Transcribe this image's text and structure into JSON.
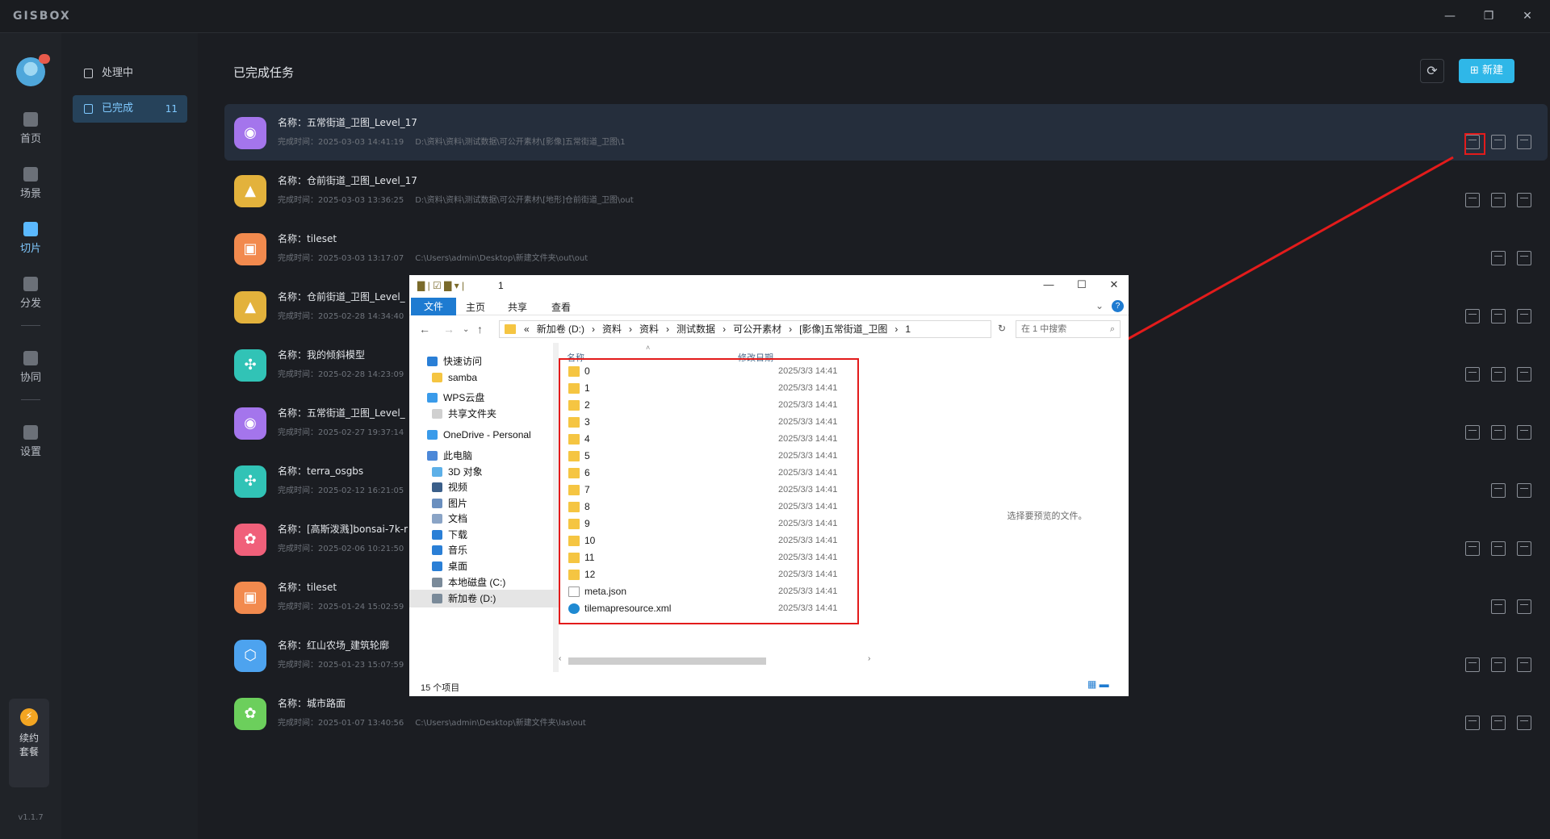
{
  "app": {
    "logo": "GISBOX",
    "version": "v1.1.7"
  },
  "window_controls": {
    "minimize": "—",
    "restore": "❐",
    "close": "✕"
  },
  "rail": {
    "items": [
      {
        "label": "首页",
        "icon": "home-icon"
      },
      {
        "label": "场景",
        "icon": "scene-icon"
      },
      {
        "label": "切片",
        "icon": "tile-icon",
        "active": true
      },
      {
        "label": "分发",
        "icon": "publish-icon"
      },
      {
        "label": "协同",
        "icon": "lock-icon"
      },
      {
        "label": "设置",
        "icon": "settings-icon"
      }
    ],
    "promo": {
      "label": "续约\n套餐",
      "bolt": "⚡"
    }
  },
  "sidenav": {
    "processing": "处理中",
    "done": "已完成",
    "done_count": "11"
  },
  "main": {
    "title": "已完成任务",
    "refresh_glyph": "⟳",
    "new_label": "新建"
  },
  "tasks": [
    {
      "name": "名称：五常街道_卫图_Level_17",
      "time": "完成时间：2025-03-03 14:41:19",
      "path": "D:\\资料\\资料\\测试数据\\可公开素材\\[影像]五常街道_卫图\\1",
      "color": "#a475ec",
      "glyph": "◉"
    },
    {
      "name": "名称：仓前街道_卫图_Level_17",
      "time": "完成时间：2025-03-03 13:36:25",
      "path": "D:\\资料\\资料\\测试数据\\可公开素材\\[地形]仓前街道_卫图\\out",
      "color": "#e3b23c",
      "glyph": "▲"
    },
    {
      "name": "名称：tileset",
      "time": "完成时间：2025-03-03 13:17:07",
      "path": "C:\\Users\\admin\\Desktop\\新建文件夹\\out\\out",
      "color": "#f28a4e",
      "glyph": "▣"
    },
    {
      "name": "名称：仓前街道_卫图_Level_",
      "time": "完成时间：2025-02-28 14:34:40",
      "path": "",
      "color": "#e3b23c",
      "glyph": "▲"
    },
    {
      "name": "名称：我的倾斜模型",
      "time": "完成时间：2025-02-28 14:23:09",
      "path": "",
      "color": "#31c3b6",
      "glyph": "✣"
    },
    {
      "name": "名称：五常街道_卫图_Level_",
      "time": "完成时间：2025-02-27 19:37:14",
      "path": "",
      "color": "#a475ec",
      "glyph": "◉"
    },
    {
      "name": "名称：terra_osgbs",
      "time": "完成时间：2025-02-12 16:21:05",
      "path": "",
      "color": "#31c3b6",
      "glyph": "✣"
    },
    {
      "name": "名称：[高斯泼溅]bonsai-7k-r",
      "time": "完成时间：2025-02-06 10:21:50",
      "path": "",
      "color": "#f0607a",
      "glyph": "✿"
    },
    {
      "name": "名称：tileset",
      "time": "完成时间：2025-01-24 15:02:59",
      "path": "",
      "color": "#f28a4e",
      "glyph": "▣"
    },
    {
      "name": "名称：红山农场_建筑轮廓",
      "time": "完成时间：2025-01-23 15:07:59",
      "path": "",
      "color": "#4da3ef",
      "glyph": "⬡"
    },
    {
      "name": "名称：城市路面",
      "time": "完成时间：2025-01-07 13:40:56",
      "path": "C:\\Users\\admin\\Desktop\\新建文件夹\\las\\out",
      "color": "#6ccf5c",
      "glyph": "✿"
    }
  ],
  "explorer": {
    "title": "1",
    "ribbon": {
      "file": "文件",
      "home": "主页",
      "share": "共享",
      "view": "查看",
      "help": "?"
    },
    "address": [
      "«",
      "新加卷 (D:)",
      "›",
      "资料",
      "›",
      "资料",
      "›",
      "测试数据",
      "›",
      "可公开素材",
      "›",
      "[影像]五常街道_卫图",
      "›",
      "1"
    ],
    "search_placeholder": "在 1 中搜索",
    "tree": [
      {
        "label": "快速访问",
        "color": "#2a7fd6"
      },
      {
        "label": "samba",
        "color": "#f5c542"
      },
      {
        "label": "WPS云盘",
        "color": "#3a9bea"
      },
      {
        "label": "共享文件夹",
        "color": "#d0d0d0"
      },
      {
        "label": "OneDrive - Personal",
        "color": "#3a9bea"
      },
      {
        "label": "此电脑",
        "color": "#4c88d8"
      },
      {
        "label": "3D 对象",
        "color": "#5db0e8"
      },
      {
        "label": "视频",
        "color": "#3b5f8a"
      },
      {
        "label": "图片",
        "color": "#6a8fbf"
      },
      {
        "label": "文档",
        "color": "#8aa4c6"
      },
      {
        "label": "下载",
        "color": "#2a7fd6"
      },
      {
        "label": "音乐",
        "color": "#2a7fd6"
      },
      {
        "label": "桌面",
        "color": "#2a7fd6"
      },
      {
        "label": "本地磁盘 (C:)",
        "color": "#7a8a99"
      },
      {
        "label": "新加卷 (D:)",
        "color": "#7a8a99"
      }
    ],
    "columns": {
      "name": "名称",
      "modified": "修改日期"
    },
    "files": [
      {
        "name": "0",
        "date": "2025/3/3 14:41",
        "type": "folder"
      },
      {
        "name": "1",
        "date": "2025/3/3 14:41",
        "type": "folder"
      },
      {
        "name": "2",
        "date": "2025/3/3 14:41",
        "type": "folder"
      },
      {
        "name": "3",
        "date": "2025/3/3 14:41",
        "type": "folder"
      },
      {
        "name": "4",
        "date": "2025/3/3 14:41",
        "type": "folder"
      },
      {
        "name": "5",
        "date": "2025/3/3 14:41",
        "type": "folder"
      },
      {
        "name": "6",
        "date": "2025/3/3 14:41",
        "type": "folder"
      },
      {
        "name": "7",
        "date": "2025/3/3 14:41",
        "type": "folder"
      },
      {
        "name": "8",
        "date": "2025/3/3 14:41",
        "type": "folder"
      },
      {
        "name": "9",
        "date": "2025/3/3 14:41",
        "type": "folder"
      },
      {
        "name": "10",
        "date": "2025/3/3 14:41",
        "type": "folder"
      },
      {
        "name": "11",
        "date": "2025/3/3 14:41",
        "type": "folder"
      },
      {
        "name": "12",
        "date": "2025/3/3 14:41",
        "type": "folder"
      },
      {
        "name": "meta.json",
        "date": "2025/3/3 14:41",
        "type": "json"
      },
      {
        "name": "tilemapresource.xml",
        "date": "2025/3/3 14:41",
        "type": "xml"
      }
    ],
    "preview_text": "选择要预览的文件。",
    "status_count": "15 个项目"
  }
}
